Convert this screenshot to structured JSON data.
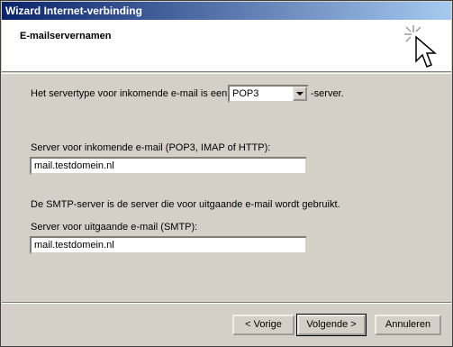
{
  "window": {
    "title": "Wizard Internet-verbinding"
  },
  "header": {
    "title": "E-mailservernamen"
  },
  "form": {
    "server_type_label": "Het servertype voor inkomende e-mail is een:",
    "server_type_value": "POP3",
    "server_type_suffix": "-server.",
    "incoming_label": "Server voor inkomende e-mail (POP3, IMAP of HTTP):",
    "incoming_value": "mail.testdomein.nl",
    "smtp_info": "De SMTP-server is de server die voor uitgaande e-mail wordt gebruikt.",
    "outgoing_label": "Server voor uitgaande e-mail (SMTP):",
    "outgoing_value": "mail.testdomein.nl"
  },
  "buttons": {
    "back": "< Vorige",
    "next": "Volgende >",
    "cancel": "Annuleren"
  },
  "icons": {
    "wizard": "wizard-cursor-sparkle-icon",
    "dropdown": "chevron-down-icon"
  }
}
